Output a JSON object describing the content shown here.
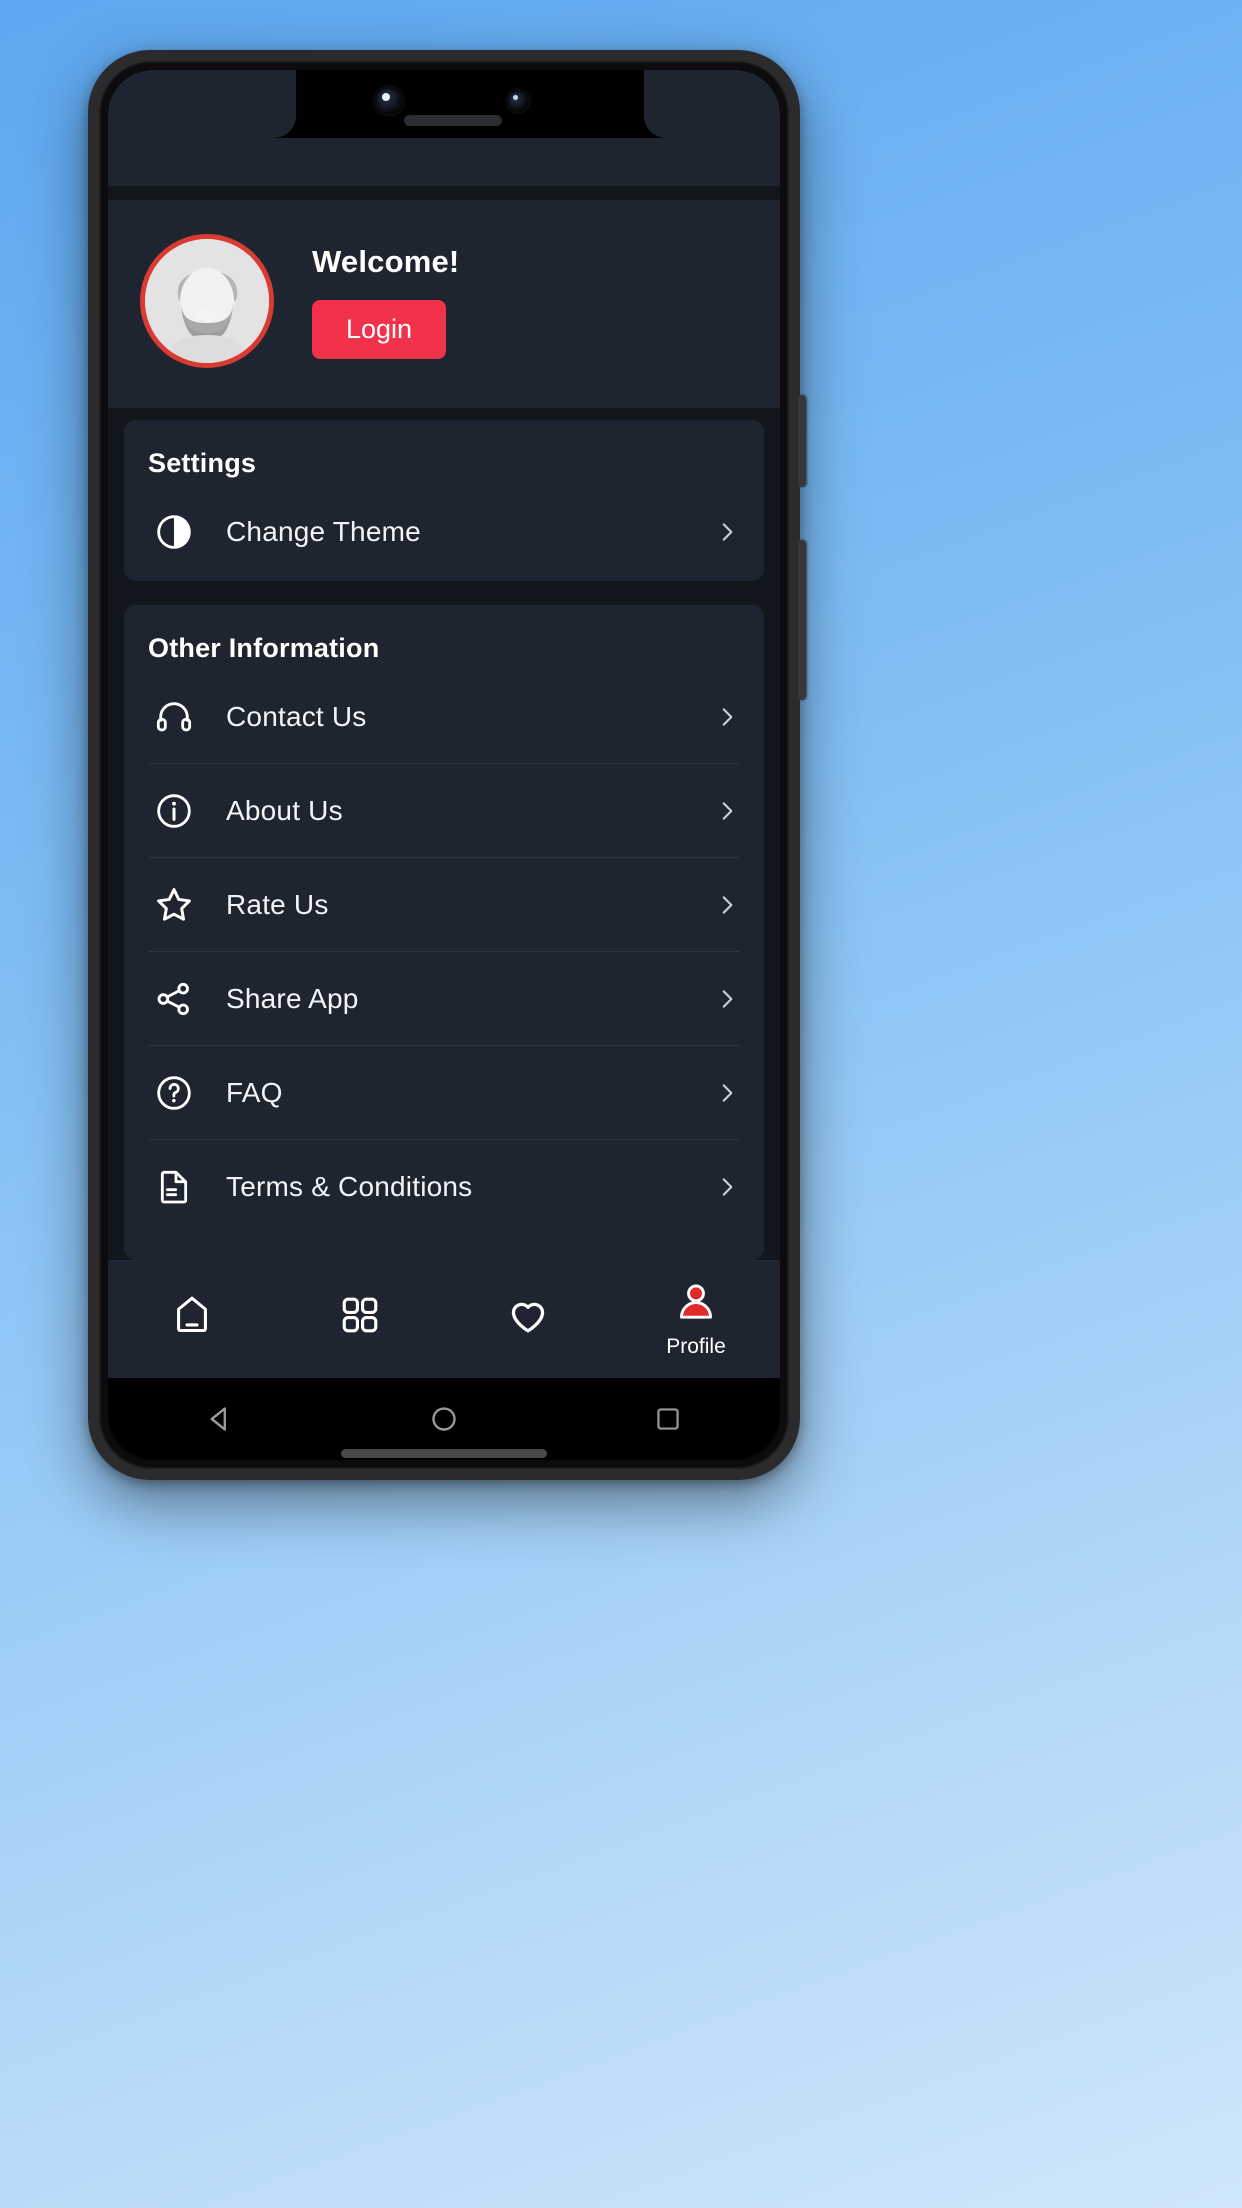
{
  "device": {
    "status_bar": {
      "camera_icons": [
        "front-camera-icon",
        "sensor-icon"
      ],
      "earpiece": "earpiece-speaker"
    },
    "android_nav": {
      "back": "back-triangle-icon",
      "home": "home-circle-icon",
      "recents": "recents-square-icon"
    }
  },
  "colors": {
    "accent_red": "#f2314b",
    "avatar_ring": "#d93b33",
    "card_bg": "#1f2530",
    "page_bg": "#12161d",
    "text_primary": "#ffffff",
    "divider": "#2d3542",
    "profile_tab_active": "#e02a2a"
  },
  "profile_header": {
    "avatar": "user-avatar",
    "welcome": "Welcome!",
    "login_label": "Login"
  },
  "settings_section": {
    "title": "Settings",
    "items": [
      {
        "label": "Change Theme",
        "icon": "contrast-icon"
      }
    ]
  },
  "other_section": {
    "title": "Other Information",
    "items": [
      {
        "label": "Contact Us",
        "icon": "headset-icon"
      },
      {
        "label": "About Us",
        "icon": "info-circle-icon"
      },
      {
        "label": "Rate Us",
        "icon": "star-outline-icon"
      },
      {
        "label": "Share App",
        "icon": "share-nodes-icon"
      },
      {
        "label": "FAQ",
        "icon": "question-circle-icon"
      },
      {
        "label": "Terms & Conditions",
        "icon": "document-text-icon"
      }
    ]
  },
  "tabbar": {
    "tabs": [
      {
        "label": "",
        "icon": "home-icon",
        "active": false
      },
      {
        "label": "",
        "icon": "grid-icon",
        "active": false
      },
      {
        "label": "",
        "icon": "heart-icon",
        "active": false
      },
      {
        "label": "Profile",
        "icon": "person-icon",
        "active": true
      }
    ]
  }
}
